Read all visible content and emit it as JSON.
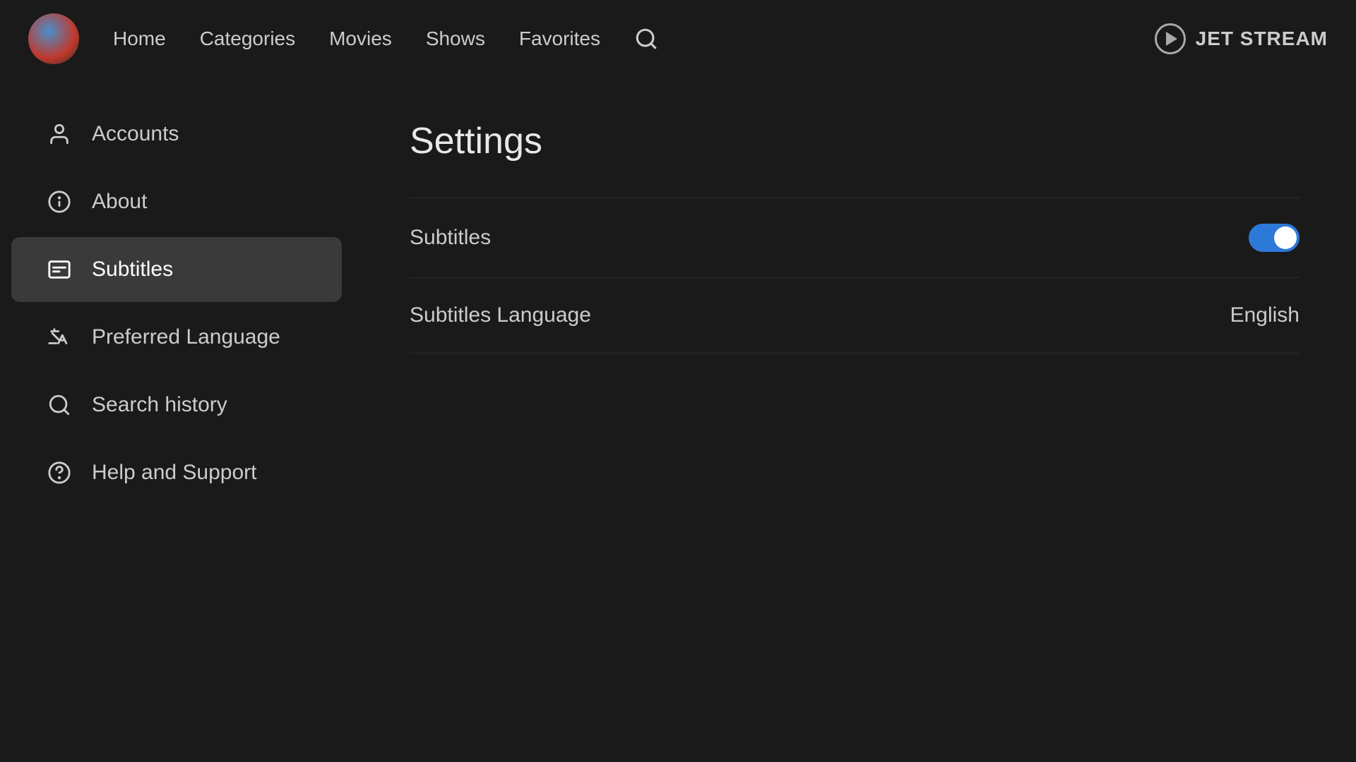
{
  "topnav": {
    "nav_links": [
      {
        "label": "Home",
        "id": "home"
      },
      {
        "label": "Categories",
        "id": "categories"
      },
      {
        "label": "Movies",
        "id": "movies"
      },
      {
        "label": "Shows",
        "id": "shows"
      },
      {
        "label": "Favorites",
        "id": "favorites"
      }
    ],
    "brand_name": "JET STREAM"
  },
  "sidebar": {
    "items": [
      {
        "id": "accounts",
        "label": "Accounts",
        "icon": "person-icon",
        "active": false
      },
      {
        "id": "about",
        "label": "About",
        "icon": "info-icon",
        "active": false
      },
      {
        "id": "subtitles",
        "label": "Subtitles",
        "icon": "subtitles-icon",
        "active": true
      },
      {
        "id": "preferred-language",
        "label": "Preferred Language",
        "icon": "translate-icon",
        "active": false
      },
      {
        "id": "search-history",
        "label": "Search history",
        "icon": "search-icon",
        "active": false
      },
      {
        "id": "help-support",
        "label": "Help and Support",
        "icon": "help-icon",
        "active": false
      }
    ]
  },
  "settings": {
    "title": "Settings",
    "rows": [
      {
        "id": "subtitles-toggle",
        "label": "Subtitles",
        "type": "toggle",
        "value": true
      },
      {
        "id": "subtitles-language",
        "label": "Subtitles Language",
        "type": "value",
        "value": "English"
      }
    ]
  }
}
